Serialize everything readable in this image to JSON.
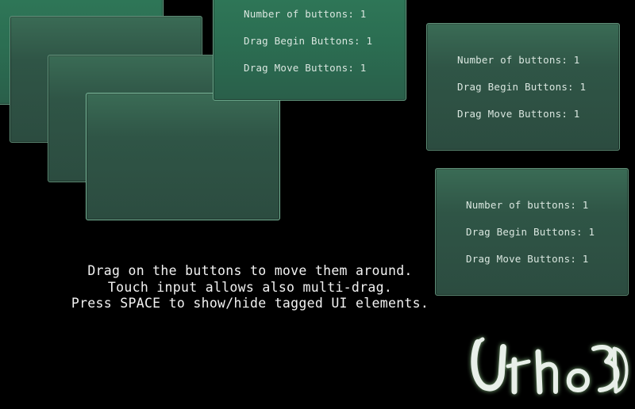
{
  "buttons": {
    "number_label": "Number of buttons: 1",
    "drag_begin_label": "Drag Begin Buttons: 1",
    "drag_move_label": "Drag Move Buttons: 1"
  },
  "instructions": {
    "line1": "Drag on the buttons to move them around.",
    "line2": "Touch input allows also multi-drag.",
    "line3": "Press SPACE to show/hide tagged UI elements."
  },
  "logo": {
    "text": "Urho3D",
    "color": "#e8efe9",
    "glow": "#7fae7a"
  },
  "colors": {
    "background": "#000000",
    "button_fill": "#2f5546",
    "button_fill_active": "#2b6e52",
    "button_border": "#5f8f78",
    "text": "#d9e6df"
  }
}
